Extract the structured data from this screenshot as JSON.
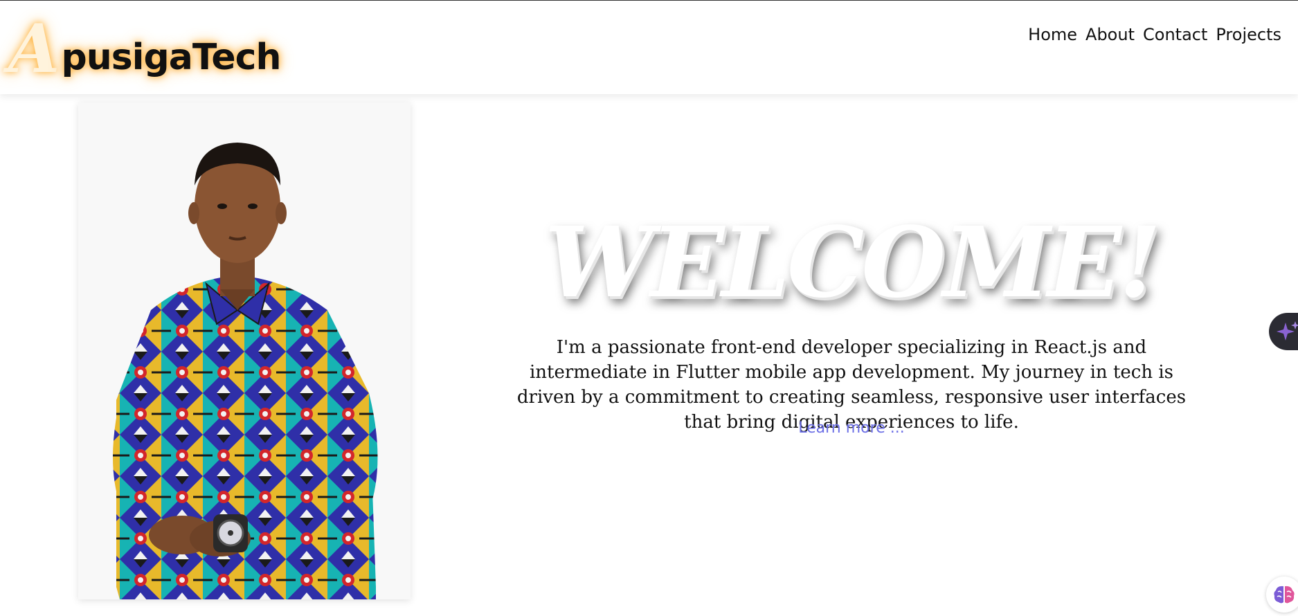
{
  "header": {
    "logo": {
      "initial": "A",
      "rest": "pusigaTech"
    },
    "nav": [
      {
        "label": "Home"
      },
      {
        "label": "About"
      },
      {
        "label": "Contact"
      },
      {
        "label": "Projects"
      }
    ]
  },
  "hero": {
    "heading": "WELCOME!",
    "intro": "I'm a passionate front-end developer specializing in React.js and intermediate in Flutter mobile app development. My journey in tech is driven by a commitment to creating seamless, responsive user interfaces that bring digital experiences to life.",
    "learn_more": "Learn more ..."
  },
  "widgets": {
    "side_tab_icon": "sparkle-icon",
    "assistant_icon": "brain-icon"
  },
  "colors": {
    "link": "#6c6fe6",
    "logo_glow": "#ffaa28",
    "side_tab_bg": "#2b2b33",
    "sparkle": "#8a63d2"
  }
}
